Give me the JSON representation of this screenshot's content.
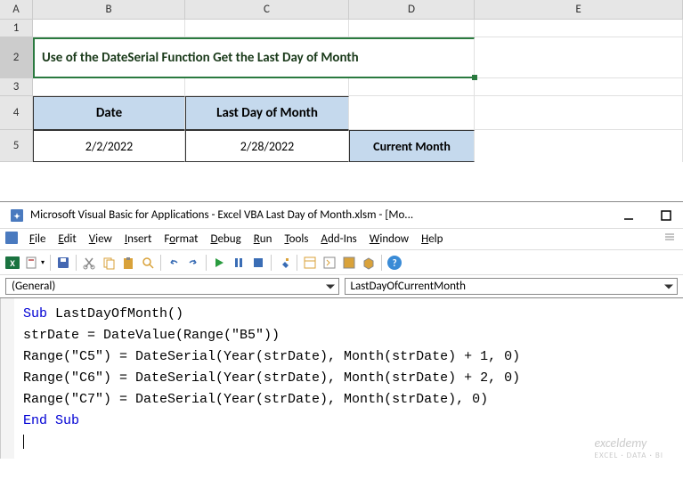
{
  "excel": {
    "columns": [
      "A",
      "B",
      "C",
      "D",
      "E"
    ],
    "rows": [
      "1",
      "2",
      "3",
      "4",
      "5"
    ],
    "title": "Use of the DateSerial Function Get the Last Day of Month",
    "table": {
      "date_header": "Date",
      "ldm_header": "Last Day of Month",
      "date_value": "2/2/2022",
      "ldm_value": "2/28/2022",
      "current_month": "Current Month"
    }
  },
  "vba": {
    "title": "Microsoft Visual Basic for Applications - Excel VBA Last Day of Month.xlsm - [Mo...",
    "menu": {
      "file": "File",
      "edit": "Edit",
      "view": "View",
      "insert": "Insert",
      "format": "Format",
      "debug": "Debug",
      "run": "Run",
      "tools": "Tools",
      "addins": "Add-Ins",
      "window": "Window",
      "help": "Help"
    },
    "proc_left": "(General)",
    "proc_right": "LastDayOfCurrentMonth",
    "code": {
      "l1a": "Sub",
      "l1b": " LastDayOfMonth()",
      "l2": "strDate = DateValue(Range(\"B5\"))",
      "l3": "Range(\"C5\") = DateSerial(Year(strDate), Month(strDate) + 1, 0)",
      "l4": "Range(\"C6\") = DateSerial(Year(strDate), Month(strDate) + 2, 0)",
      "l5": "Range(\"C7\") = DateSerial(Year(strDate), Month(strDate), 0)",
      "l6": "End Sub"
    }
  },
  "watermark": {
    "brand": "exceldemy",
    "sub": "EXCEL · DATA · BI"
  }
}
